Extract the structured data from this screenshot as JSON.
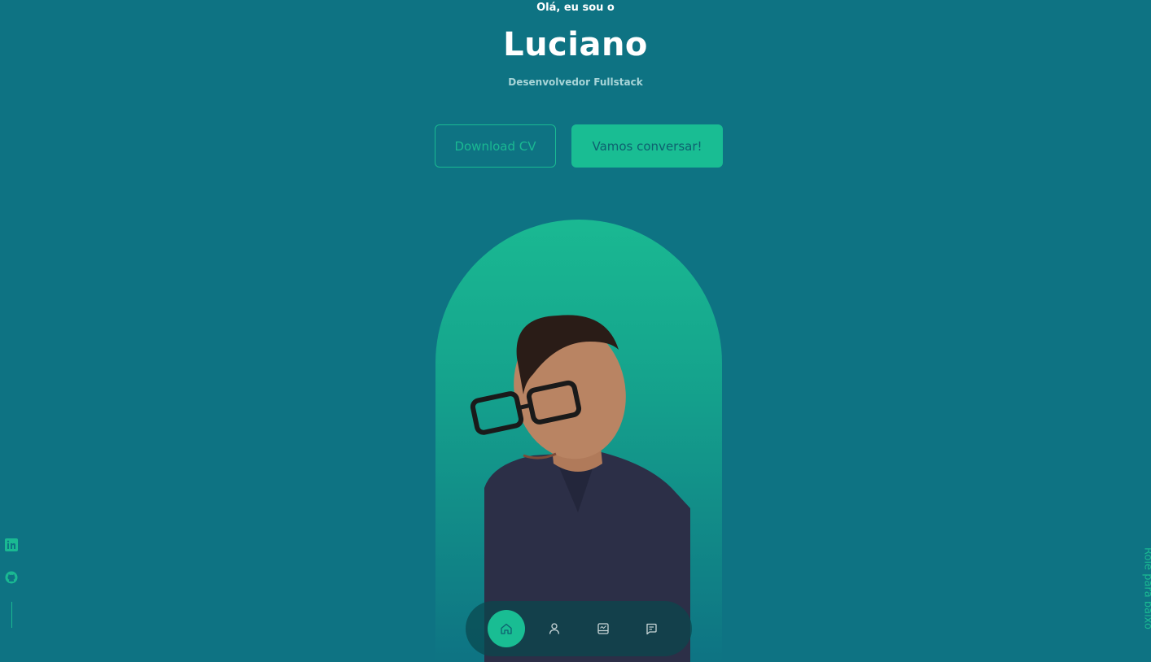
{
  "hero": {
    "greeting": "Olá, eu sou o",
    "name": "Luciano",
    "role": "Desenvolvedor Fullstack"
  },
  "buttons": {
    "download_cv": "Download CV",
    "contact": "Vamos conversar!"
  },
  "socials": [
    {
      "icon": "linkedin-icon"
    },
    {
      "icon": "github-icon"
    }
  ],
  "scroll_hint": "Role para baixo",
  "nav": {
    "items": [
      {
        "icon": "home-icon",
        "active": true
      },
      {
        "icon": "user-icon",
        "active": false
      },
      {
        "icon": "portfolio-icon",
        "active": false
      },
      {
        "icon": "message-icon",
        "active": false
      }
    ]
  },
  "colors": {
    "background": "#0e7383",
    "accent": "#19bd93",
    "muted_text": "#a8d5d8"
  }
}
